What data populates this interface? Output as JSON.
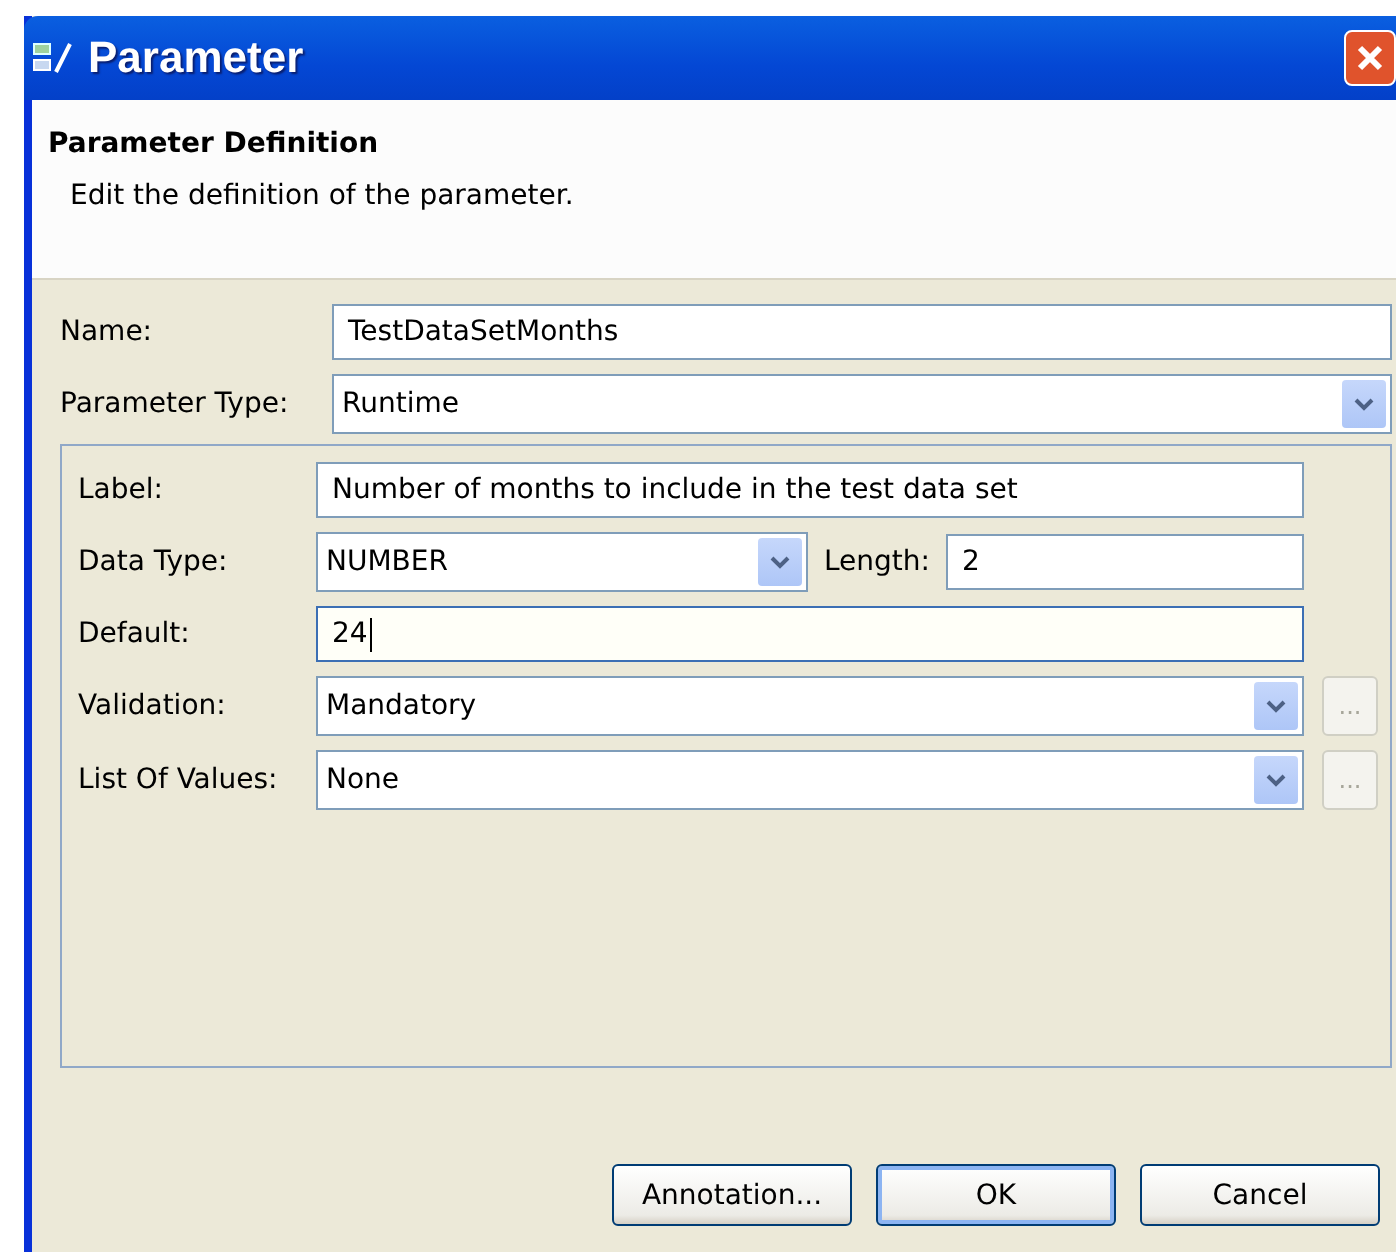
{
  "window": {
    "title": "Parameter"
  },
  "header": {
    "title": "Parameter Definition",
    "description": "Edit the definition of the parameter."
  },
  "fields": [
    {
      "kind": "text",
      "label": "Name:",
      "value": "TestDataSetMonths",
      "focused": false
    },
    {
      "kind": "combo",
      "label": "Parameter Type:",
      "value": "Runtime"
    }
  ],
  "group_fields": [
    {
      "kind": "text",
      "label": "Label:",
      "value": "Number of months to include in the test data set",
      "focused": false
    },
    {
      "kind": "combo_length",
      "label": "Data Type:",
      "value": "NUMBER",
      "length_label": "Length:",
      "length_value": "2"
    },
    {
      "kind": "text",
      "label": "Default:",
      "value": "24",
      "focused": true
    },
    {
      "kind": "combo_ellipsis",
      "label": "Validation:",
      "value": "Mandatory",
      "ellipsis": "...",
      "ellipsis_disabled": true
    },
    {
      "kind": "combo_ellipsis",
      "label": "List Of Values:",
      "value": "None",
      "ellipsis": "...",
      "ellipsis_disabled": true
    }
  ],
  "buttons": [
    {
      "label": "Annotation...",
      "default": false
    },
    {
      "label": "OK",
      "default": true
    },
    {
      "label": "Cancel",
      "default": false
    }
  ]
}
